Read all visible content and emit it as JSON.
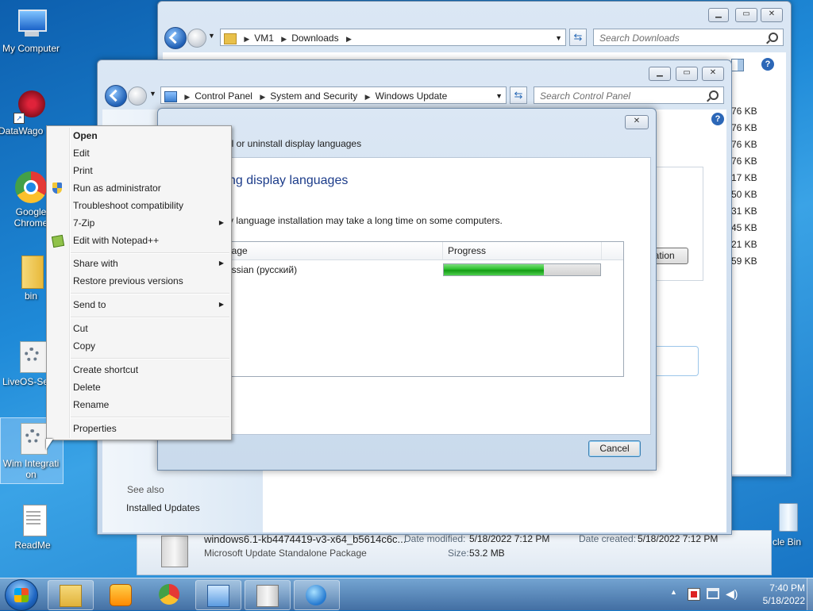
{
  "desktop": {
    "icons": [
      {
        "label": "My Computer"
      },
      {
        "label": "DataWago"
      },
      {
        "label": "Google Chrome"
      },
      {
        "label": "bin"
      },
      {
        "label": "LiveOS-Se"
      },
      {
        "label": "Wim Integrati on"
      },
      {
        "label": "ReadMe"
      },
      {
        "label": "cle Bin"
      }
    ]
  },
  "explorer": {
    "breadcrumb": [
      "VM1",
      "Downloads"
    ],
    "search_placeholder": "Search Downloads",
    "sizes": [
      "76 KB",
      "76 KB",
      "76 KB",
      "76 KB",
      "17 KB",
      "50 KB",
      "31 KB",
      "45 KB",
      "21 KB",
      "59 KB"
    ],
    "details": {
      "filename": "windows6.1-kb4474419-v3-x64_b5614c6c...",
      "type": "Microsoft Update Standalone Package",
      "date_modified_label": "Date modified:",
      "date_modified": "5/18/2022 7:12 PM",
      "date_created_label": "Date created:",
      "date_created": "5/18/2022 7:12 PM",
      "size_label": "Size:",
      "size": "53.2 MB"
    }
  },
  "control_panel": {
    "breadcrumb": [
      "Control Panel",
      "System and Security",
      "Windows Update"
    ],
    "search_placeholder": "Search Control Panel",
    "see_also": "See also",
    "installed_updates": "Installed Updates",
    "partial_button": "lation"
  },
  "dialog": {
    "title_partial": "ll or uninstall display languages",
    "heading_partial": "ng display languages",
    "note_partial": "y language installation may take a long time on some computers.",
    "col_language_partial": "uage",
    "col_progress": "Progress",
    "row_language_partial": "ussian (русский)",
    "progress_fraction": 0.64,
    "cancel": "Cancel"
  },
  "context_menu": {
    "items": {
      "open": "Open",
      "edit": "Edit",
      "print": "Print",
      "run_as_admin": "Run as administrator",
      "troubleshoot": "Troubleshoot compatibility",
      "seven_zip": "7-Zip",
      "notepadpp": "Edit with Notepad++",
      "share_with": "Share with",
      "restore": "Restore previous versions",
      "send_to": "Send to",
      "cut": "Cut",
      "copy": "Copy",
      "create_shortcut": "Create shortcut",
      "delete": "Delete",
      "rename": "Rename",
      "properties": "Properties"
    }
  },
  "taskbar": {
    "time": "7:40 PM",
    "date": "5/18/2022"
  },
  "colors": {
    "accent": "#1f5fb4",
    "progress_green": "#2cc02c"
  }
}
